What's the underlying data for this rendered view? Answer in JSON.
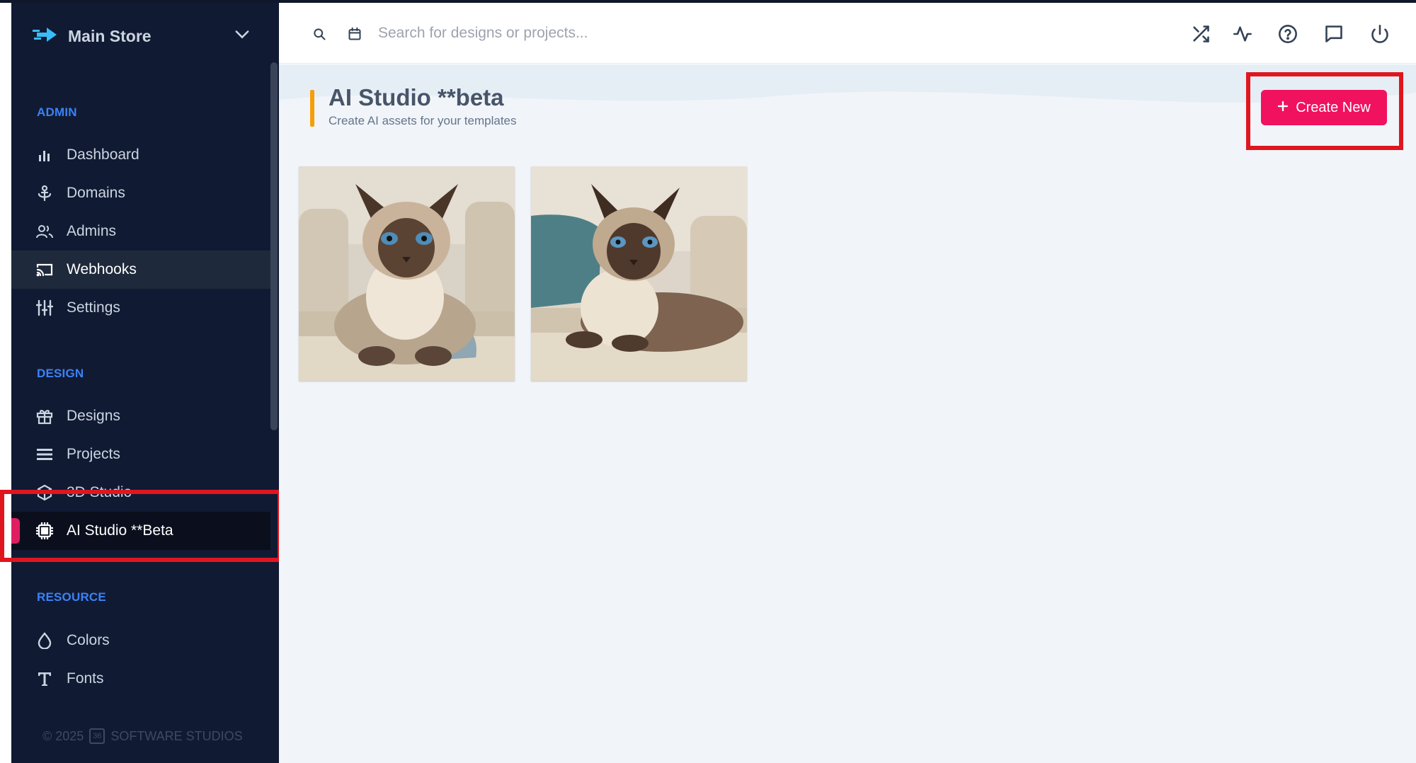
{
  "sidebar": {
    "store_name": "Main Store",
    "sections": {
      "admin": "ADMIN",
      "design": "DESIGN",
      "resource": "RESOURCE"
    },
    "admin_items": [
      {
        "label": "Dashboard",
        "icon": "bar-chart-icon"
      },
      {
        "label": "Domains",
        "icon": "anchor-icon"
      },
      {
        "label": "Admins",
        "icon": "users-icon"
      },
      {
        "label": "Webhooks",
        "icon": "cast-icon"
      },
      {
        "label": "Settings",
        "icon": "sliders-icon"
      }
    ],
    "design_items": [
      {
        "label": "Designs",
        "icon": "gift-icon"
      },
      {
        "label": "Projects",
        "icon": "list-icon"
      },
      {
        "label": "3D Studio",
        "icon": "cube-icon"
      },
      {
        "label": "AI Studio **Beta",
        "icon": "chip-icon"
      }
    ],
    "resource_items": [
      {
        "label": "Colors",
        "icon": "droplet-icon"
      },
      {
        "label": "Fonts",
        "icon": "type-icon"
      }
    ],
    "footer": "© 2025",
    "footer_company": "SOFTWARE STUDIOS"
  },
  "header": {
    "search_placeholder": "Search for designs or projects...",
    "icons": [
      "search-icon",
      "calendar-icon",
      "shuffle-icon",
      "activity-icon",
      "help-circle-icon",
      "message-icon",
      "power-icon"
    ]
  },
  "main": {
    "title": "AI Studio **beta",
    "subtitle": "Create AI assets for your templates",
    "create_button": "Create New",
    "assets": [
      {
        "name": "siamese-cat-on-sofa-1"
      },
      {
        "name": "siamese-cat-on-sofa-2"
      }
    ]
  },
  "help": {
    "label": "?"
  },
  "colors": {
    "sidebar_bg": "#111a33",
    "accent_blue": "#3b82f6",
    "primary_pink": "#f0125e",
    "title_accent": "#f59e0b",
    "help_purple": "#6d28d9"
  }
}
